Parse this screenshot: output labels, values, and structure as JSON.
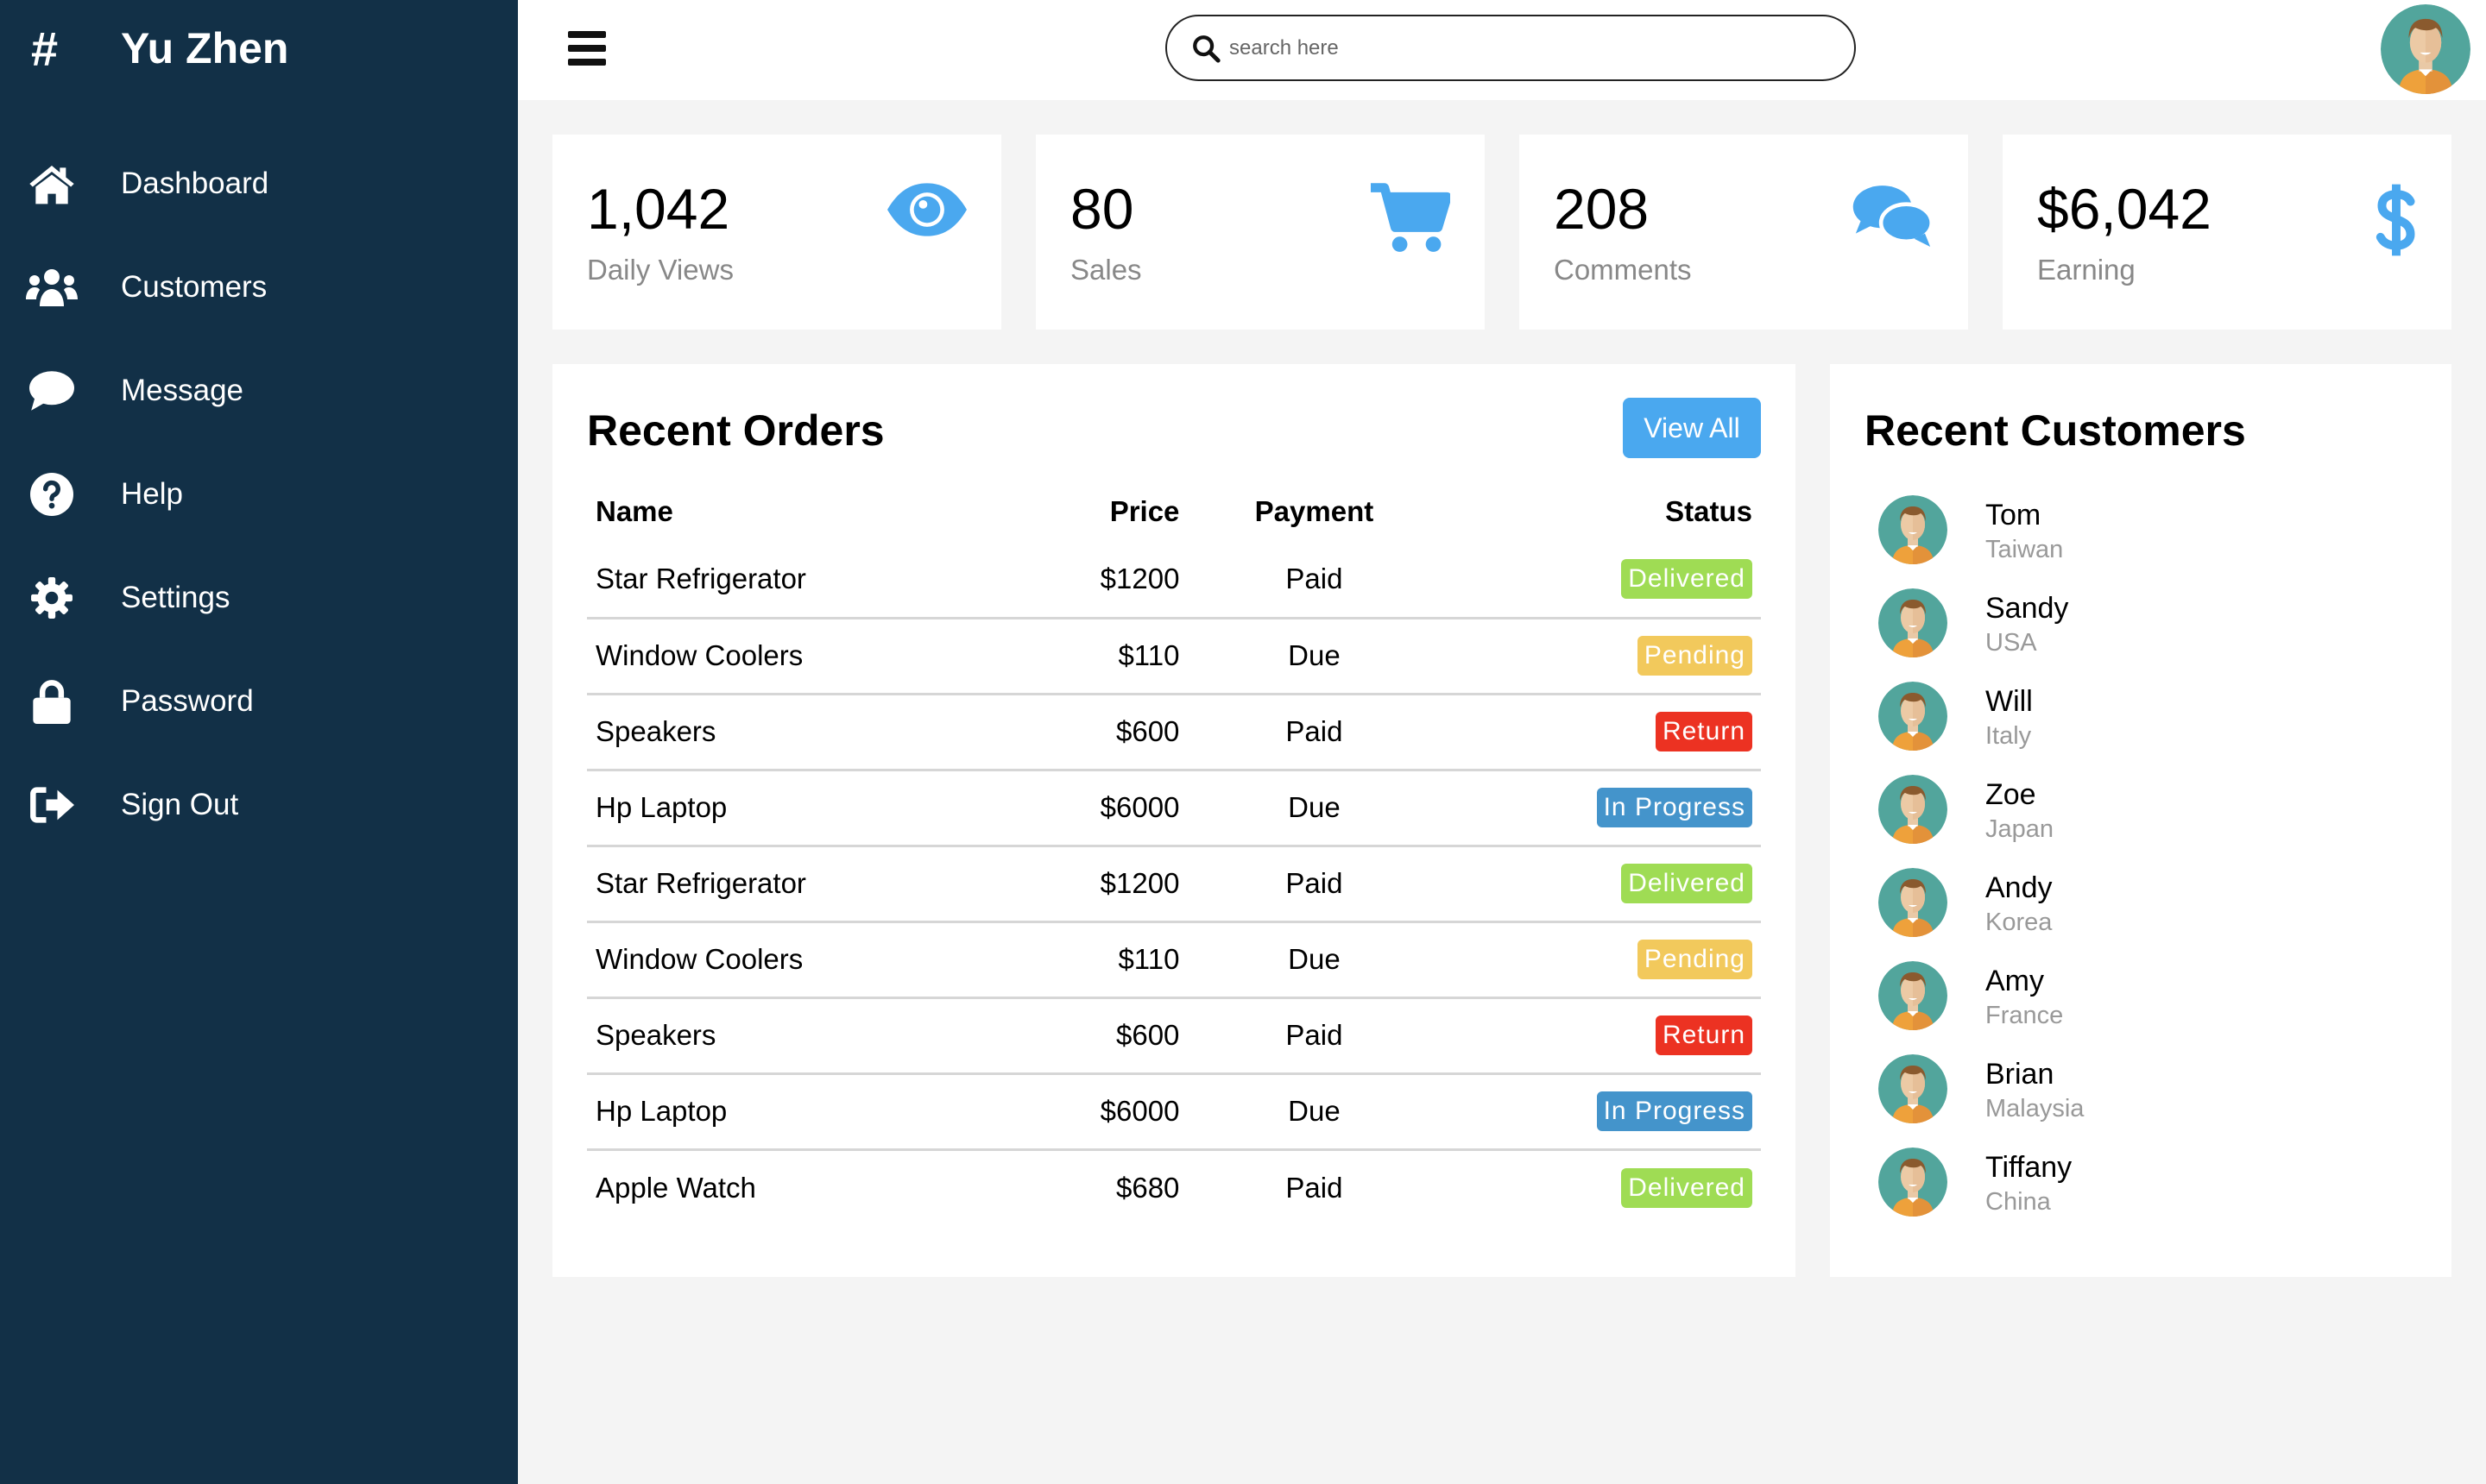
{
  "brand": {
    "icon": "hash-icon",
    "name": "Yu Zhen"
  },
  "nav": [
    {
      "label": "Dashboard",
      "icon": "home-icon"
    },
    {
      "label": "Customers",
      "icon": "users-icon"
    },
    {
      "label": "Message",
      "icon": "chat-icon"
    },
    {
      "label": "Help",
      "icon": "help-icon"
    },
    {
      "label": "Settings",
      "icon": "gear-icon"
    },
    {
      "label": "Password",
      "icon": "lock-icon"
    },
    {
      "label": "Sign Out",
      "icon": "sign-out-icon"
    }
  ],
  "search": {
    "placeholder": "search here",
    "value": ""
  },
  "cards": [
    {
      "value": "1,042",
      "label": "Daily Views",
      "icon": "eye-icon"
    },
    {
      "value": "80",
      "label": "Sales",
      "icon": "cart-icon"
    },
    {
      "value": "208",
      "label": "Comments",
      "icon": "comments-icon"
    },
    {
      "value": "$6,042",
      "label": "Earning",
      "icon": "dollar-icon"
    }
  ],
  "orders": {
    "title": "Recent Orders",
    "view_all": "View All",
    "columns": [
      "Name",
      "Price",
      "Payment",
      "Status"
    ],
    "rows": [
      [
        "Star Refrigerator",
        "$1200",
        "Paid",
        "Delivered"
      ],
      [
        "Window Coolers",
        "$110",
        "Due",
        "Pending"
      ],
      [
        "Speakers",
        "$600",
        "Paid",
        "Return"
      ],
      [
        "Hp Laptop",
        "$6000",
        "Due",
        "In Progress"
      ],
      [
        "Star Refrigerator",
        "$1200",
        "Paid",
        "Delivered"
      ],
      [
        "Window Coolers",
        "$110",
        "Due",
        "Pending"
      ],
      [
        "Speakers",
        "$600",
        "Paid",
        "Return"
      ],
      [
        "Hp Laptop",
        "$6000",
        "Due",
        "In Progress"
      ],
      [
        "Apple Watch",
        "$680",
        "Paid",
        "Delivered"
      ]
    ]
  },
  "status_colors": {
    "Delivered": "#9fdc54",
    "Pending": "#f2c95c",
    "Return": "#ec3222",
    "In Progress": "#4494cb"
  },
  "customers": {
    "title": "Recent Customers",
    "items": [
      {
        "name": "Tom",
        "country": "Taiwan"
      },
      {
        "name": "Sandy",
        "country": "USA"
      },
      {
        "name": "Will",
        "country": "Italy"
      },
      {
        "name": "Zoe",
        "country": "Japan"
      },
      {
        "name": "Andy",
        "country": "Korea"
      },
      {
        "name": "Amy",
        "country": "France"
      },
      {
        "name": "Brian",
        "country": "Malaysia"
      },
      {
        "name": "Tiffany",
        "country": "China"
      }
    ]
  },
  "colors": {
    "sidebar": "#123047",
    "accent": "#4aa8ef"
  }
}
